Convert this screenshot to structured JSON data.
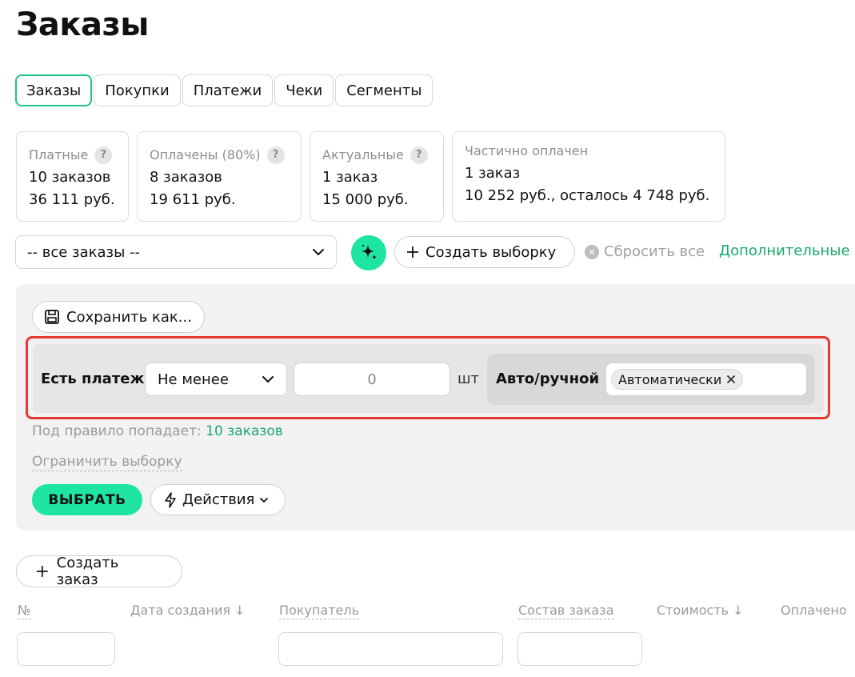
{
  "page": {
    "title": "Заказы"
  },
  "tabs": [
    "Заказы",
    "Покупки",
    "Платежи",
    "Чеки",
    "Сегменты"
  ],
  "stats": [
    {
      "label": "Платные",
      "line1": "10 заказов",
      "line2": "36 111 руб.",
      "help": "?"
    },
    {
      "label": "Оплачены (80%)",
      "line1": "8 заказов",
      "line2": "19 611 руб.",
      "help": "?"
    },
    {
      "label": "Актуальные",
      "line1": "1 заказ",
      "line2": "15 000 руб.",
      "help": "?"
    },
    {
      "label": "Частично оплачен",
      "line1": "1 заказ",
      "line2": "10 252 руб., осталось 4 748 руб."
    }
  ],
  "filterbar": {
    "select_value": "-- все заказы --",
    "create_selection": "Создать выборку",
    "reset_all": "Сбросить все",
    "more": "Дополнительные"
  },
  "rules": {
    "save_as": "Сохранить как...",
    "rule1_label": "Есть платеж",
    "rule1_operator": "Не менее",
    "rule1_value": "0",
    "rule1_unit": "шт",
    "rule2_label": "Авто/ручной",
    "rule2_chip": "Автоматически",
    "hit_prefix": "Под правило попадает:",
    "hit_count": "10 заказов",
    "limit": "Ограничить выборку",
    "choose": "ВЫБРАТЬ",
    "actions": "Действия"
  },
  "create_order": "Создать заказ",
  "table": {
    "headers": [
      "№",
      "Дата создания ↓",
      "Покупатель",
      "Состав заказа",
      "Стоимость ↓",
      "Оплачено"
    ]
  },
  "colors": {
    "accent": "#1fe5a3",
    "accent_text": "#1aa870",
    "highlight": "#e53935"
  }
}
